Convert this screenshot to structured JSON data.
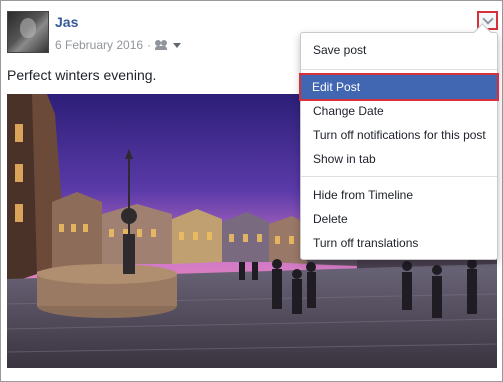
{
  "post": {
    "author": "Jas",
    "date": "6 February 2016",
    "separator": "·",
    "audience_icon": "friends-icon",
    "text": "Perfect winters evening."
  },
  "options_button": {
    "icon": "chevron-down-icon"
  },
  "menu": {
    "items": [
      {
        "label": "Save post"
      },
      {
        "label": "Edit Post",
        "selected": true
      },
      {
        "label": "Change Date"
      },
      {
        "label": "Turn off notifications for this post"
      },
      {
        "label": "Show in tab"
      },
      {
        "label": "Hide from Timeline"
      },
      {
        "label": "Delete"
      },
      {
        "label": "Turn off translations"
      }
    ]
  },
  "colors": {
    "link": "#365899",
    "highlight": "#4267b2",
    "annotation_red": "#d6303a"
  }
}
